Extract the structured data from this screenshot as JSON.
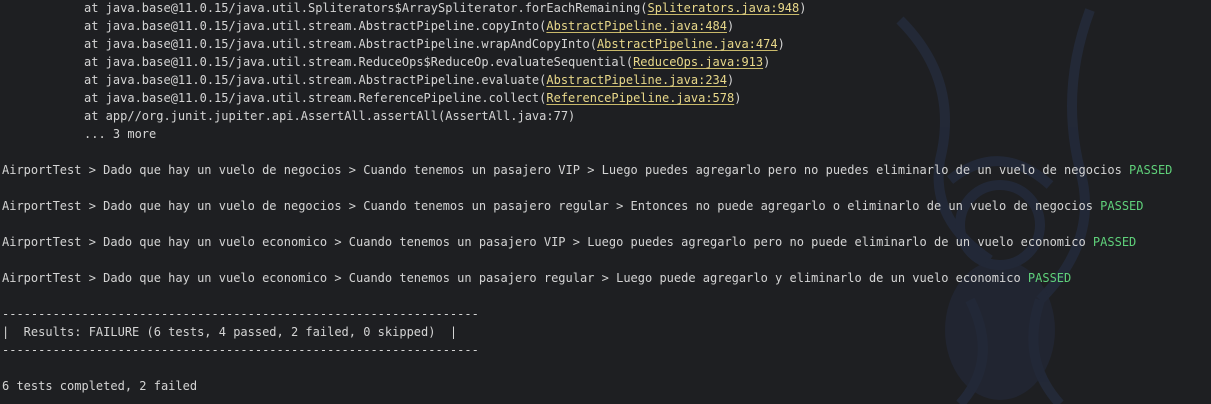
{
  "theme": {
    "background": "#1e1f22",
    "text": "#d4d4d4",
    "link": "#e8d88a",
    "passed": "#5fd07a"
  },
  "stack_trace": [
    {
      "prefix": "at java.base@11.0.15/java.util.Spliterators$ArraySpliterator.forEachRemaining(",
      "link": "Spliterators.java:948",
      "suffix": ")"
    },
    {
      "prefix": "at java.base@11.0.15/java.util.stream.AbstractPipeline.copyInto(",
      "link": "AbstractPipeline.java:484",
      "suffix": ")"
    },
    {
      "prefix": "at java.base@11.0.15/java.util.stream.AbstractPipeline.wrapAndCopyInto(",
      "link": "AbstractPipeline.java:474",
      "suffix": ")"
    },
    {
      "prefix": "at java.base@11.0.15/java.util.stream.ReduceOps$ReduceOp.evaluateSequential(",
      "link": "ReduceOps.java:913",
      "suffix": ")"
    },
    {
      "prefix": "at java.base@11.0.15/java.util.stream.AbstractPipeline.evaluate(",
      "link": "AbstractPipeline.java:234",
      "suffix": ")"
    },
    {
      "prefix": "at java.base@11.0.15/java.util.stream.ReferencePipeline.collect(",
      "link": "ReferencePipeline.java:578",
      "suffix": ")"
    },
    {
      "text": "at app//org.junit.jupiter.api.AssertAll.assertAll(AssertAll.java:77)"
    },
    {
      "text": "... 3 more"
    }
  ],
  "test_results": [
    {
      "text": "AirportTest > Dado que hay un vuelo de negocios > Cuando tenemos un pasajero VIP > Luego puedes agregarlo pero no puedes eliminarlo de un vuelo de negocios ",
      "status": "PASSED"
    },
    {
      "text": "AirportTest > Dado que hay un vuelo de negocios > Cuando tenemos un pasajero regular > Entonces no puede agregarlo o eliminarlo de un vuelo de negocios ",
      "status": "PASSED"
    },
    {
      "text": "AirportTest > Dado que hay un vuelo economico > Cuando tenemos un pasajero VIP > Luego puedes agregarlo pero no puede eliminarlo de un vuelo economico ",
      "status": "PASSED"
    },
    {
      "text": "AirportTest > Dado que hay un vuelo economico > Cuando tenemos un pasajero regular > Luego puede agregarlo y eliminarlo de un vuelo economico ",
      "status": "PASSED"
    }
  ],
  "summary": {
    "top_rule": "------------------------------------------------------------------",
    "results_line": "|  Results: FAILURE (6 tests, 4 passed, 2 failed, 0 skipped)  |",
    "bottom_rule": "------------------------------------------------------------------"
  },
  "footer": {
    "completed_line": "6 tests completed, 2 failed"
  }
}
